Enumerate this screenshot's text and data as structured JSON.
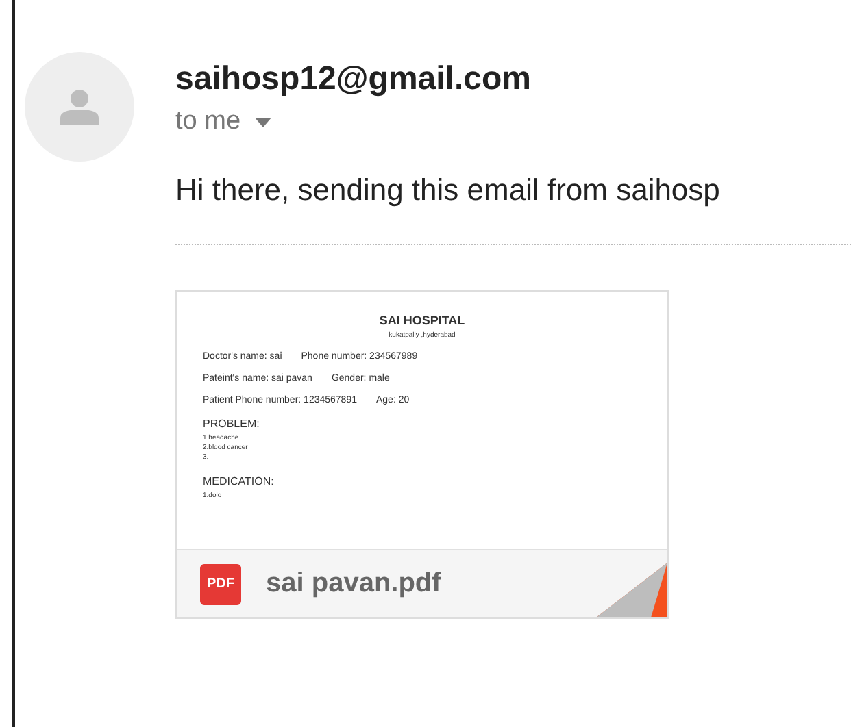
{
  "message": {
    "sender": "saihosp12@gmail.com",
    "recipient": "to me",
    "body": "Hi there, sending this email from saihosp"
  },
  "attachment": {
    "file_name": "sai pavan.pdf",
    "file_type": "PDF",
    "preview": {
      "title": "SAI HOSPITAL",
      "subtitle": "kukatpally ,hyderabad",
      "rows": [
        [
          "Doctor's name:  sai",
          "Phone number:  234567989"
        ],
        [
          "Pateint's name:  sai pavan",
          "Gender:  male"
        ],
        [
          "Patient Phone number: 1234567891",
          "Age: 20"
        ]
      ],
      "sections": [
        {
          "heading": "PROBLEM:",
          "items": [
            "1.headache",
            "2.blood cancer",
            "3."
          ]
        },
        {
          "heading": "MEDICATION:",
          "items": [
            "1.dolo"
          ]
        }
      ]
    }
  }
}
